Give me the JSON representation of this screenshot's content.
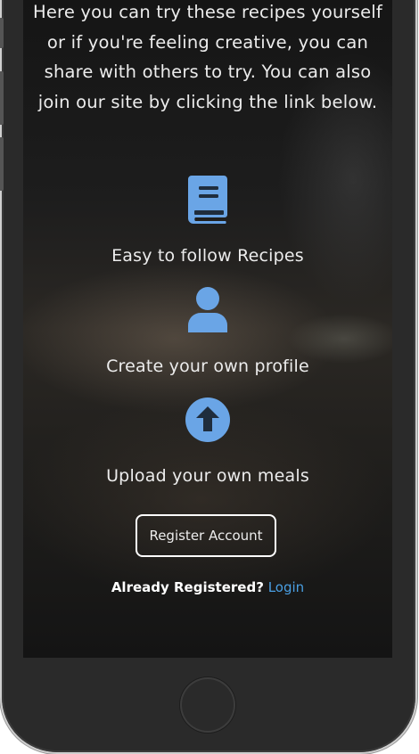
{
  "intro": {
    "lines": [
      "Here you can try these recipes yourself",
      "or if you're feeling creative, you can",
      "share with others to try. You can also",
      "join our site by clicking the link below."
    ]
  },
  "features": [
    {
      "icon": "book-icon",
      "label": "Easy to follow Recipes"
    },
    {
      "icon": "user-icon",
      "label": "Create your own profile"
    },
    {
      "icon": "upload-arrow-icon",
      "label": "Upload your own meals"
    }
  ],
  "register_button": "Register Account",
  "login_prompt": {
    "question": "Already Registered?",
    "link": "Login"
  },
  "colors": {
    "icon_blue": "#6aa5e6",
    "link_blue": "#4a9fe3",
    "text": "#ececec"
  }
}
